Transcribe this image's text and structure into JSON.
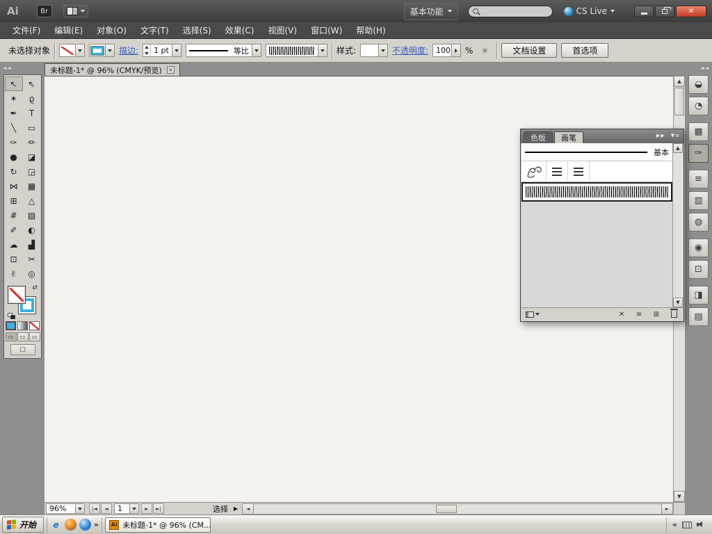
{
  "colors": {
    "accent_stroke_blue": "#3ab0e2",
    "link_blue": "#3b5fc0",
    "close_button_red": "#c33d23",
    "cs_live_orb_blue": "#2a8fd0",
    "none_slash_red": "#d23a2e",
    "ai_taskbar_orange": "#e88b00"
  },
  "titlebar": {
    "app_logo": "Ai",
    "bridge_label": "Br",
    "workspace_switcher": "基本功能",
    "search_value": "",
    "search_placeholder": "",
    "cs_live_label": "CS Live",
    "close_glyph": "✕"
  },
  "menubar": {
    "items": [
      {
        "name": "menu-file",
        "label": "文件(F)"
      },
      {
        "name": "menu-edit",
        "label": "编辑(E)"
      },
      {
        "name": "menu-object",
        "label": "对象(O)"
      },
      {
        "name": "menu-type",
        "label": "文字(T)"
      },
      {
        "name": "menu-select",
        "label": "选择(S)"
      },
      {
        "name": "menu-effect",
        "label": "效果(C)"
      },
      {
        "name": "menu-view",
        "label": "视图(V)"
      },
      {
        "name": "menu-window",
        "label": "窗口(W)"
      },
      {
        "name": "menu-help",
        "label": "帮助(H)"
      }
    ]
  },
  "controlbar": {
    "selection_status": "未选择对象",
    "stroke_link": "描边:",
    "stroke_weight_value": "1 pt",
    "width_profile_value": "等比",
    "style_label": "样式:",
    "opacity_link": "不透明度:",
    "opacity_value": "100",
    "opacity_unit": "%",
    "recolor_glyph": "✳",
    "document_setup_button": "文档设置",
    "preferences_button": "首选项"
  },
  "document": {
    "tab_title": "未标题-1* @ 96% (CMYK/预览)",
    "tab_close_glyph": "✕"
  },
  "tools": [
    {
      "name": "selection-tool",
      "glyph": "↖",
      "state": "active"
    },
    {
      "name": "direct-selection-tool",
      "glyph": "⇖",
      "state": ""
    },
    {
      "name": "magic-wand-tool",
      "glyph": "✶",
      "state": ""
    },
    {
      "name": "lasso-tool",
      "glyph": "ϱ",
      "state": ""
    },
    {
      "name": "pen-tool",
      "glyph": "✒",
      "state": ""
    },
    {
      "name": "type-tool",
      "glyph": "T",
      "state": ""
    },
    {
      "name": "line-segment-tool",
      "glyph": "╲",
      "state": ""
    },
    {
      "name": "rectangle-tool",
      "glyph": "▭",
      "state": ""
    },
    {
      "name": "paintbrush-tool",
      "glyph": "✑",
      "state": ""
    },
    {
      "name": "pencil-tool",
      "glyph": "✏",
      "state": ""
    },
    {
      "name": "blob-brush-tool",
      "glyph": "●",
      "state": ""
    },
    {
      "name": "eraser-tool",
      "glyph": "◪",
      "state": ""
    },
    {
      "name": "rotate-tool",
      "glyph": "↻",
      "state": ""
    },
    {
      "name": "scale-tool",
      "glyph": "◲",
      "state": ""
    },
    {
      "name": "width-tool",
      "glyph": "⋈",
      "state": ""
    },
    {
      "name": "free-transform-tool",
      "glyph": "▦",
      "state": ""
    },
    {
      "name": "shape-builder-tool",
      "glyph": "⊞",
      "state": ""
    },
    {
      "name": "perspective-grid-tool",
      "glyph": "△",
      "state": ""
    },
    {
      "name": "mesh-tool",
      "glyph": "#",
      "state": ""
    },
    {
      "name": "gradient-tool",
      "glyph": "▧",
      "state": ""
    },
    {
      "name": "eyedropper-tool",
      "glyph": "✐",
      "state": ""
    },
    {
      "name": "blend-tool",
      "glyph": "◐",
      "state": ""
    },
    {
      "name": "symbol-sprayer-tool",
      "glyph": "☁",
      "state": ""
    },
    {
      "name": "column-graph-tool",
      "glyph": "▟",
      "state": ""
    },
    {
      "name": "artboard-tool",
      "glyph": "⊡",
      "state": ""
    },
    {
      "name": "slice-tool",
      "glyph": "✂",
      "state": ""
    },
    {
      "name": "hand-tool",
      "glyph": "✌",
      "state": ""
    },
    {
      "name": "zoom-tool",
      "glyph": "◎",
      "state": ""
    }
  ],
  "dock_icons": [
    {
      "name": "color-panel-icon",
      "glyph": "◒",
      "state": ""
    },
    {
      "name": "color-guide-panel-icon",
      "glyph": "◔",
      "state": ""
    },
    {
      "name": "dock-separator",
      "glyph": "",
      "state": "sep"
    },
    {
      "name": "swatches-panel-icon",
      "glyph": "▦",
      "state": ""
    },
    {
      "name": "brushes-panel-icon",
      "glyph": "✑",
      "state": "active"
    },
    {
      "name": "dock-separator",
      "glyph": "",
      "state": "sep"
    },
    {
      "name": "stroke-panel-icon",
      "glyph": "≡",
      "state": ""
    },
    {
      "name": "gradient-panel-icon",
      "glyph": "▥",
      "state": ""
    },
    {
      "name": "transparency-panel-icon",
      "glyph": "◍",
      "state": ""
    },
    {
      "name": "dock-separator",
      "glyph": "",
      "state": "sep"
    },
    {
      "name": "symbols-panel-icon",
      "glyph": "◉",
      "state": ""
    },
    {
      "name": "artboards-panel-icon",
      "glyph": "⊡",
      "state": ""
    },
    {
      "name": "dock-separator",
      "glyph": "",
      "state": "sep"
    },
    {
      "name": "appearance-panel-icon",
      "glyph": "◨",
      "state": ""
    },
    {
      "name": "layers-panel-icon",
      "glyph": "▤",
      "state": ""
    }
  ],
  "brushes_panel": {
    "tabs": [
      {
        "name": "tab-swatches",
        "label": "色板",
        "state": "inactive"
      },
      {
        "name": "tab-brushes",
        "label": "画笔",
        "state": "active"
      }
    ],
    "collapse_glyph": "▶▶",
    "menu_glyph": "▼≡",
    "basic_brush_label": "基本",
    "footer": {
      "remove_glyph": "✕",
      "options_glyph": "≡",
      "new_glyph": "⊞"
    }
  },
  "statusbar": {
    "zoom_value": "96%",
    "nav_first": "|◄",
    "nav_prev": "◄",
    "artboard_number": "1",
    "nav_next": "►",
    "nav_last": "►|",
    "tool_status": "选择",
    "flyout_glyph": "▶"
  },
  "scroll_glyphs": {
    "up": "▲",
    "down": "▼",
    "left": "◄",
    "right": "►"
  },
  "taskbar": {
    "start_label": "开始",
    "quicklaunch_e": "e",
    "quicklaunch_more": "»",
    "task_button_title": "未标题-1* @ 96% (CM...",
    "ai_badge": "Ai",
    "tray_chevron": "«"
  }
}
